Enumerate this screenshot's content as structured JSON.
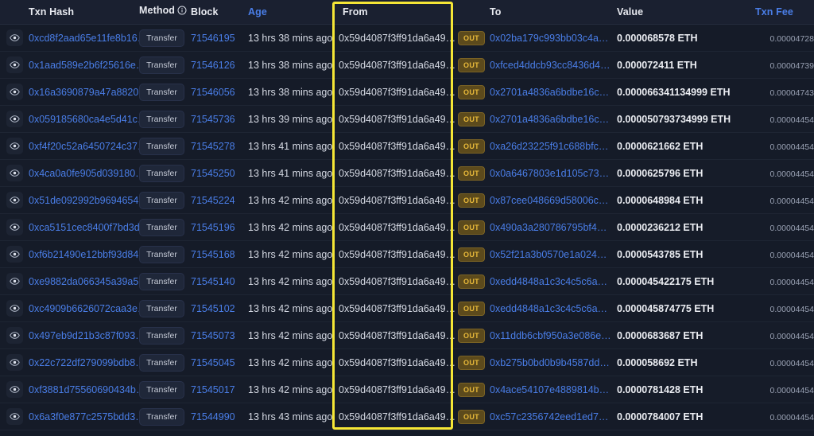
{
  "table": {
    "columns": [
      {
        "key": "eye",
        "label": "",
        "accent": false
      },
      {
        "key": "hash",
        "label": "Txn Hash",
        "accent": false
      },
      {
        "key": "method",
        "label": "Method",
        "accent": false,
        "info": true
      },
      {
        "key": "block",
        "label": "Block",
        "accent": false
      },
      {
        "key": "age",
        "label": "Age",
        "accent": true
      },
      {
        "key": "from",
        "label": "From",
        "accent": false
      },
      {
        "key": "dir",
        "label": "",
        "accent": false
      },
      {
        "key": "to",
        "label": "To",
        "accent": false
      },
      {
        "key": "value",
        "label": "Value",
        "accent": false
      },
      {
        "key": "fee",
        "label": "Txn Fee",
        "accent": true
      }
    ],
    "rows": [
      {
        "hash": "0xcd8f2aad65e11fe8b16…",
        "method": "Transfer",
        "block": "71546195",
        "age": "13 hrs 38 mins ago",
        "from": "0x59d4087f3ff91da6a49…",
        "direction": "OUT",
        "to": "0x02ba179c993bb03c4a…",
        "value": "0.000068578 ETH",
        "fee": "0.00004728"
      },
      {
        "hash": "0x1aad589e2b6f25616e…",
        "method": "Transfer",
        "block": "71546126",
        "age": "13 hrs 38 mins ago",
        "from": "0x59d4087f3ff91da6a49…",
        "direction": "OUT",
        "to": "0xfced4ddcb93cc8436d4…",
        "value": "0.000072411 ETH",
        "fee": "0.00004739"
      },
      {
        "hash": "0x16a3690879a47a8820…",
        "method": "Transfer",
        "block": "71546056",
        "age": "13 hrs 38 mins ago",
        "from": "0x59d4087f3ff91da6a49…",
        "direction": "OUT",
        "to": "0x2701a4836a6bdbe16c…",
        "value": "0.000066341134999 ETH",
        "fee": "0.00004743"
      },
      {
        "hash": "0x059185680ca4e5d41c…",
        "method": "Transfer",
        "block": "71545736",
        "age": "13 hrs 39 mins ago",
        "from": "0x59d4087f3ff91da6a49…",
        "direction": "OUT",
        "to": "0x2701a4836a6bdbe16c…",
        "value": "0.000050793734999 ETH",
        "fee": "0.00004454"
      },
      {
        "hash": "0xf4f20c52a6450724c37…",
        "method": "Transfer",
        "block": "71545278",
        "age": "13 hrs 41 mins ago",
        "from": "0x59d4087f3ff91da6a49…",
        "direction": "OUT",
        "to": "0xa26d23225f91c688bfc…",
        "value": "0.0000621662 ETH",
        "fee": "0.00004454"
      },
      {
        "hash": "0x4ca0a0fe905d039180…",
        "method": "Transfer",
        "block": "71545250",
        "age": "13 hrs 41 mins ago",
        "from": "0x59d4087f3ff91da6a49…",
        "direction": "OUT",
        "to": "0x0a6467803e1d105c73…",
        "value": "0.0000625796 ETH",
        "fee": "0.00004454"
      },
      {
        "hash": "0x51de092992b9694654…",
        "method": "Transfer",
        "block": "71545224",
        "age": "13 hrs 42 mins ago",
        "from": "0x59d4087f3ff91da6a49…",
        "direction": "OUT",
        "to": "0x87cee048669d58006c…",
        "value": "0.0000648984 ETH",
        "fee": "0.00004454"
      },
      {
        "hash": "0xca5151cec8400f7bd3d…",
        "method": "Transfer",
        "block": "71545196",
        "age": "13 hrs 42 mins ago",
        "from": "0x59d4087f3ff91da6a49…",
        "direction": "OUT",
        "to": "0x490a3a280786795bf4…",
        "value": "0.0000236212 ETH",
        "fee": "0.00004454"
      },
      {
        "hash": "0xf6b21490e12bbf93d84…",
        "method": "Transfer",
        "block": "71545168",
        "age": "13 hrs 42 mins ago",
        "from": "0x59d4087f3ff91da6a49…",
        "direction": "OUT",
        "to": "0x52f21a3b0570e1a024…",
        "value": "0.0000543785 ETH",
        "fee": "0.00004454"
      },
      {
        "hash": "0xe9882da066345a39a5…",
        "method": "Transfer",
        "block": "71545140",
        "age": "13 hrs 42 mins ago",
        "from": "0x59d4087f3ff91da6a49…",
        "direction": "OUT",
        "to": "0xedd4848a1c3c4c5c6a…",
        "value": "0.000045422175 ETH",
        "fee": "0.00004454"
      },
      {
        "hash": "0xc4909b6626072caa3e…",
        "method": "Transfer",
        "block": "71545102",
        "age": "13 hrs 42 mins ago",
        "from": "0x59d4087f3ff91da6a49…",
        "direction": "OUT",
        "to": "0xedd4848a1c3c4c5c6a…",
        "value": "0.000045874775 ETH",
        "fee": "0.00004454"
      },
      {
        "hash": "0x497eb9d21b3c87f093…",
        "method": "Transfer",
        "block": "71545073",
        "age": "13 hrs 42 mins ago",
        "from": "0x59d4087f3ff91da6a49…",
        "direction": "OUT",
        "to": "0x11ddb6cbf950a3e086e…",
        "value": "0.0000683687 ETH",
        "fee": "0.00004454"
      },
      {
        "hash": "0x22c722df279099bdb8…",
        "method": "Transfer",
        "block": "71545045",
        "age": "13 hrs 42 mins ago",
        "from": "0x59d4087f3ff91da6a49…",
        "direction": "OUT",
        "to": "0xb275b0bd0b9b4587dd…",
        "value": "0.000058692 ETH",
        "fee": "0.00004454"
      },
      {
        "hash": "0xf3881d75560690434b…",
        "method": "Transfer",
        "block": "71545017",
        "age": "13 hrs 42 mins ago",
        "from": "0x59d4087f3ff91da6a49…",
        "direction": "OUT",
        "to": "0x4ace54107e4889814b…",
        "value": "0.0000781428 ETH",
        "fee": "0.00004454"
      },
      {
        "hash": "0x6a3f0e877c2575bdd3…",
        "method": "Transfer",
        "block": "71544990",
        "age": "13 hrs 43 mins ago",
        "from": "0x59d4087f3ff91da6a49…",
        "direction": "OUT",
        "to": "0xc57c2356742eed1ed7…",
        "value": "0.0000784007 ETH",
        "fee": "0.00004454"
      }
    ]
  },
  "annotation": {
    "highlight_color": "#f5e636",
    "highlighted_column": "From"
  },
  "colors": {
    "link": "#4a7ee8",
    "row_bg": "#151b28",
    "header_bg": "#1a2030",
    "out_badge_text": "#e8b93a"
  }
}
